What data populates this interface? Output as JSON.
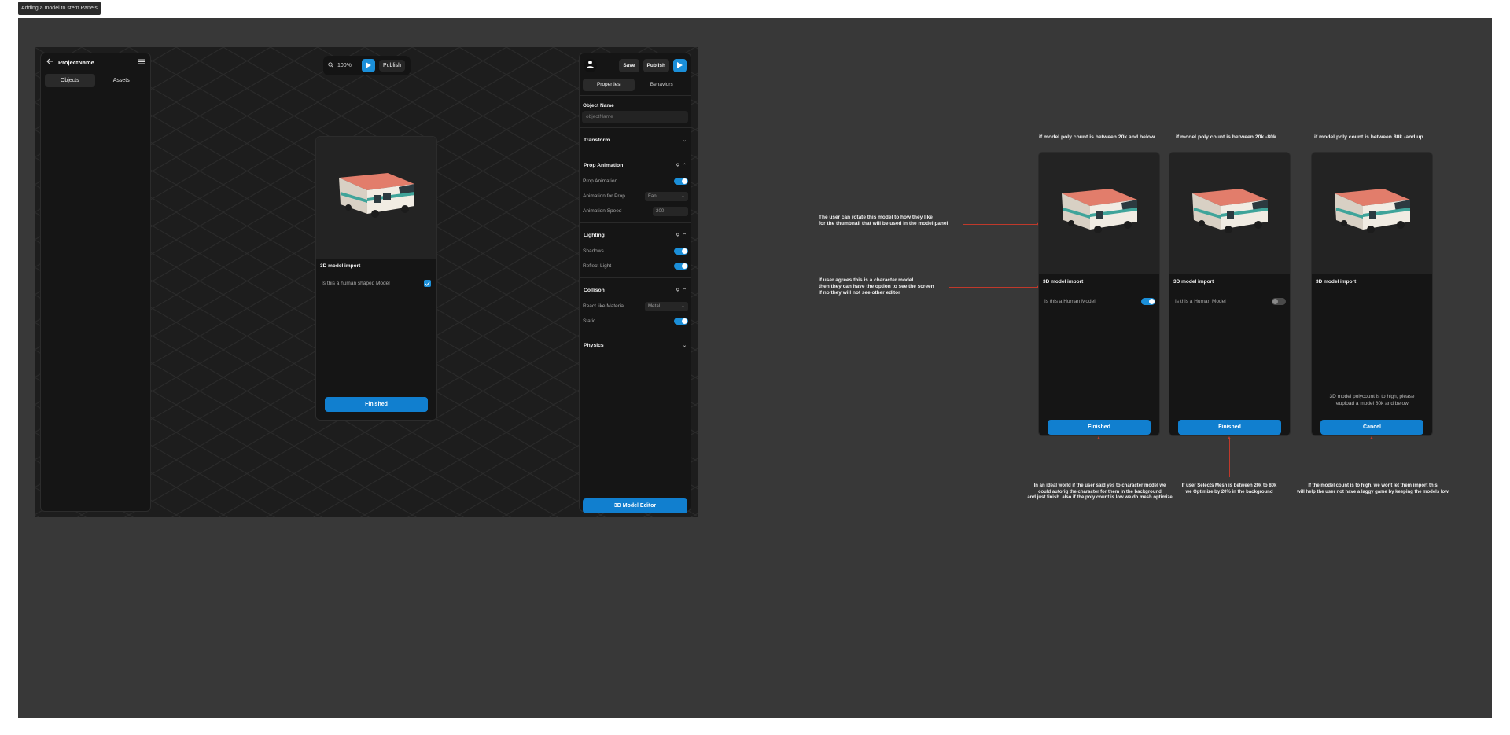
{
  "frame_label": "Adding a model to stem Panels",
  "left_panel": {
    "project_name": "ProjectName",
    "tabs": [
      "Objects",
      "Assets"
    ]
  },
  "toolbar": {
    "zoom": "100%",
    "publish": "Publish"
  },
  "import_modal": {
    "title": "3D model import",
    "question": "Is this a human shaped Model",
    "checked": true,
    "finish": "Finished"
  },
  "right_panel": {
    "save": "Save",
    "publish": "Publish",
    "tabs": [
      "Properties",
      "Behaviors"
    ],
    "object_name_label": "Object Name",
    "object_name_placeholder": "objectName",
    "sections": {
      "transform": "Transform",
      "prop_animation": "Prop Animation",
      "lighting": "Lighting",
      "collision": "Collison",
      "physics": "Physics"
    },
    "props": {
      "prop_animation": "Prop Animation",
      "animation_for_prop": "Animation for Prop",
      "animation_for_prop_value": "Fan",
      "animation_speed": "Animation Speed",
      "animation_speed_value": "200",
      "shadows": "Shadows",
      "reflect_light": "Reflect Light",
      "react_like_material": "React like Material",
      "react_like_material_value": "Metal",
      "static": "Static"
    },
    "editor_button": "3D Model Editor"
  },
  "annotations": {
    "rotate_note": [
      "The user can rotate this model to how they like",
      "for the thumbnail that will be used in the model panel"
    ],
    "character_note": [
      "if user agrees this is a character model",
      "then they can have the option to see the screen",
      "if no they will not see other editor"
    ],
    "case1_note": [
      "In an ideal world if the user said yes to character model we",
      "could autorig the character for them in the background",
      "and just finish. also if the poly count is low we do  mesh optimize"
    ],
    "case2_note": [
      "If user Selects  Mesh  is between 20k to 80k",
      "we Optimize by 20% in the  background"
    ],
    "case3_note": [
      "If the model count is to high, we wont let them import this",
      "will help the user not have a laggy game by keeping the models low"
    ]
  },
  "cases": [
    {
      "label": "if model poly count is between 20k  and below",
      "title": "3D model import",
      "question": "Is this a Human Model",
      "toggle_on": true,
      "button": "Finished"
    },
    {
      "label": "if model poly count is between 20k -80k",
      "title": "3D model import",
      "question": "Is this a Human Model",
      "toggle_on": false,
      "button": "Finished"
    },
    {
      "label": "if model poly count is between 80k -and up",
      "title": "3D model import",
      "warning": [
        "3D model polycount is to high, please",
        "reupload a model 80k and below."
      ],
      "button": "Cancel"
    }
  ],
  "icons": {
    "back": "arrow-left-icon",
    "menu": "menu-icon",
    "search": "search-icon",
    "play": "play-icon",
    "user": "user-icon",
    "pin": "pin-icon",
    "chevron": "chevron-icon",
    "vehicle": "rv-model-thumbnail"
  },
  "colors": {
    "accent": "#1b8fd9",
    "annotation_line": "#c0392b",
    "canvas": "#383838",
    "panel": "#151515"
  }
}
